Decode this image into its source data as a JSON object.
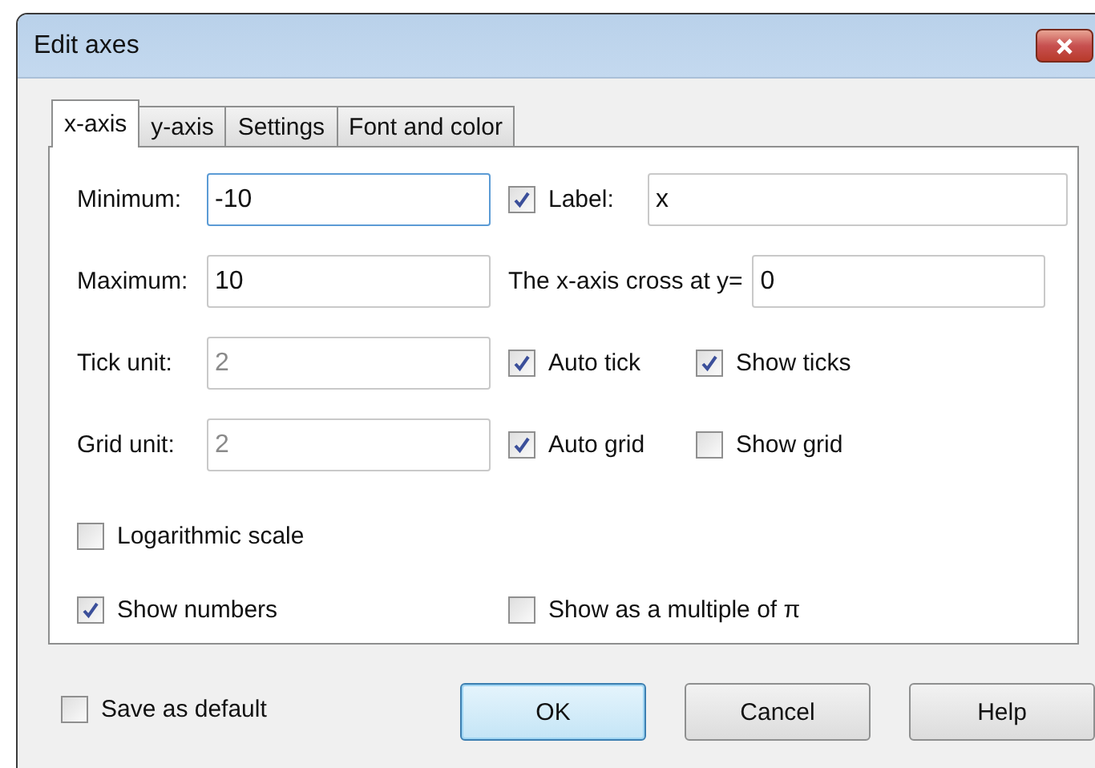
{
  "window": {
    "title": "Edit axes"
  },
  "tabs": [
    {
      "label": "x-axis",
      "selected": true
    },
    {
      "label": "y-axis",
      "selected": false
    },
    {
      "label": "Settings",
      "selected": false
    },
    {
      "label": "Font and color",
      "selected": false
    }
  ],
  "range_fields": [
    {
      "label": "Minimum:",
      "value": "-10",
      "disabled": false,
      "focused": true
    },
    {
      "label": "Maximum:",
      "value": "10",
      "disabled": false,
      "focused": false
    },
    {
      "label": "Tick unit:",
      "value": "2",
      "disabled": true,
      "focused": false
    },
    {
      "label": "Grid unit:",
      "value": "2",
      "disabled": true,
      "focused": false
    }
  ],
  "label_option": {
    "label": "Label:",
    "checked": true,
    "value": "x"
  },
  "cross_field": {
    "label": "The x-axis cross at y=",
    "value": "0"
  },
  "tick_options": [
    {
      "label": "Auto tick",
      "checked": true
    },
    {
      "label": "Show ticks",
      "checked": true
    }
  ],
  "grid_options": [
    {
      "label": "Auto grid",
      "checked": true
    },
    {
      "label": "Show grid",
      "checked": false
    }
  ],
  "logarithmic": {
    "label": "Logarithmic scale",
    "checked": false
  },
  "show_numbers": {
    "label": "Show numbers",
    "checked": true
  },
  "pi_multiple": {
    "label": "Show as a multiple of π",
    "checked": false
  },
  "save_default": {
    "label": "Save as default",
    "checked": false
  },
  "buttons": [
    {
      "label": "OK",
      "default": true
    },
    {
      "label": "Cancel",
      "default": false
    },
    {
      "label": "Help",
      "default": false
    }
  ]
}
